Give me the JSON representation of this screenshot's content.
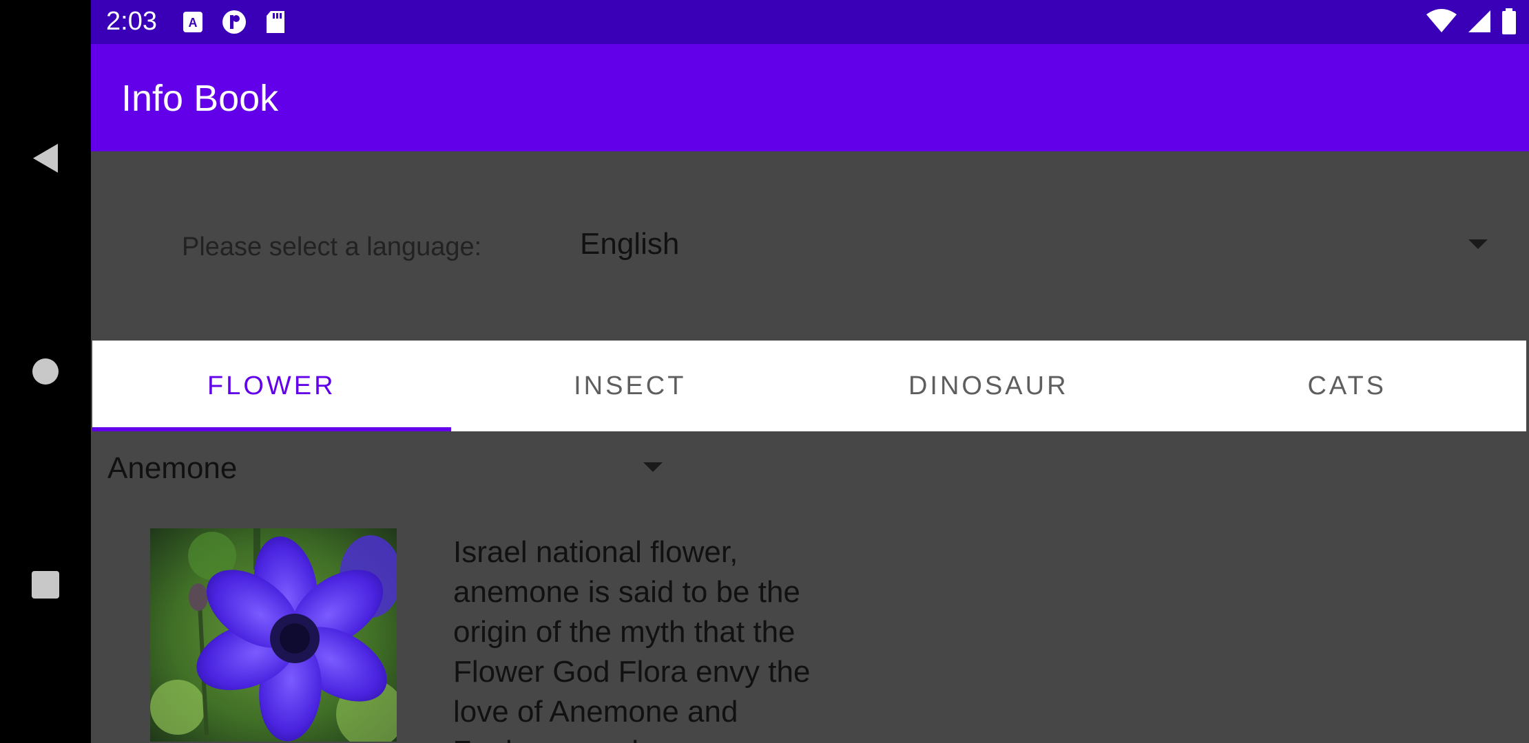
{
  "status_bar": {
    "time": "2:03",
    "left_icons": [
      "a-icon",
      "r-icon",
      "sd-card-icon"
    ],
    "right_icons": [
      "wifi-icon",
      "signal-icon",
      "battery-icon"
    ]
  },
  "app_bar": {
    "title": "Info Book"
  },
  "language": {
    "label": "Please select a language:",
    "selected": "English"
  },
  "tabs": [
    {
      "label": "FLOWER",
      "active": true
    },
    {
      "label": "INSECT",
      "active": false
    },
    {
      "label": "DINOSAUR",
      "active": false
    },
    {
      "label": "CATS",
      "active": false
    }
  ],
  "item_select": {
    "selected": "Anemone"
  },
  "content": {
    "image_subject": "purple anemone flower",
    "description": "Israel national flower, anemone is said to be the origin of the myth that the Flower God Flora envy the love of Anemone and Zephyrus and"
  },
  "colors": {
    "primary": "#6200ea",
    "status_bar": "#3a00b8",
    "background": "#474747"
  }
}
